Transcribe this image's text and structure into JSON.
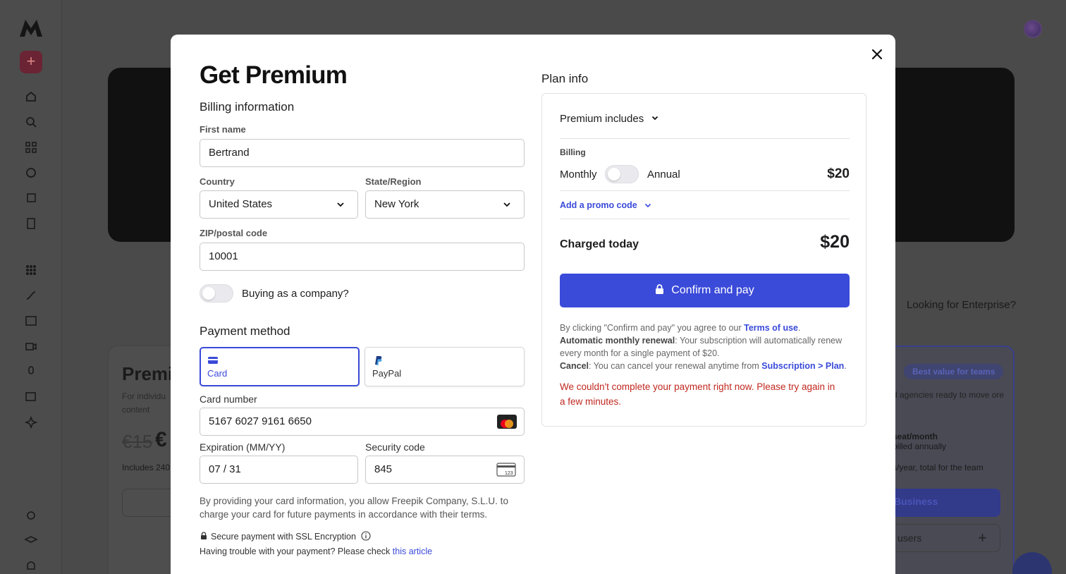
{
  "modal": {
    "title": "Get Premium",
    "billing_heading": "Billing information",
    "first_name": {
      "label": "First name",
      "value": "Bertrand"
    },
    "country": {
      "label": "Country",
      "value": "United States"
    },
    "state": {
      "label": "State/Region",
      "value": "New York"
    },
    "zip": {
      "label": "ZIP/postal code",
      "value": "10001"
    },
    "company_toggle_label": "Buying as a company?",
    "payment_heading": "Payment method",
    "payment_options": [
      {
        "label": "Card",
        "selected": true,
        "icon": "card-icon"
      },
      {
        "label": "PayPal",
        "selected": false,
        "icon": "paypal-icon"
      }
    ],
    "card_number": {
      "label": "Card number",
      "value": "5167 6027 9161 6650",
      "brand_icon": "mastercard-icon"
    },
    "expiration": {
      "label": "Expiration (MM/YY)",
      "value": "07 / 31"
    },
    "security_code": {
      "label": "Security code",
      "value": "845",
      "icon": "cvc-card-icon"
    },
    "card_consent": "By providing your card information, you allow Freepik Company, S.L.U. to charge your card for future payments in accordance with their terms.",
    "ssl_note": "Secure payment with SSL Encryption",
    "trouble_text": "Having trouble with your payment? Please check",
    "trouble_link": "this article"
  },
  "plan": {
    "heading": "Plan info",
    "includes_label": "Premium includes",
    "billing_label": "Billing",
    "monthly_label": "Monthly",
    "annual_label": "Annual",
    "price": "$20",
    "promo_label": "Add a promo code",
    "charged_today_label": "Charged today",
    "charged_today_value": "$20",
    "confirm_label": "Confirm and pay",
    "legal_prefix": "By clicking \"Confirm and pay\" you agree to our",
    "terms_link": "Terms of use",
    "auto_renew_label": "Automatic monthly renewal",
    "auto_renew_text": ": Your subscription will automatically renew every month for a single payment of $20.",
    "cancel_label": "Cancel",
    "cancel_text": ": You can cancel your renewal anytime from",
    "cancel_link": "Subscription > Plan",
    "error": "We couldn't complete your payment right now. Please try again in a few minutes."
  },
  "background": {
    "enterprise_link": "Looking for Enterprise?",
    "left_card_title": "Premiu",
    "left_card_desc": "For individu content",
    "left_card_old_price": "€15",
    "left_card_new_price": "€",
    "left_card_includes": "Includes 240",
    "badge": "Best value for teams",
    "right_card_desc": "d agencies ready to move ore",
    "right_card_seat": "seat/month",
    "right_card_billed": "billed annually",
    "right_card_total": "s/year, total for the team",
    "right_card_btn": "Business",
    "right_card_users": "users"
  },
  "colors": {
    "accent": "#3a4ad9",
    "error": "#c0281f"
  }
}
